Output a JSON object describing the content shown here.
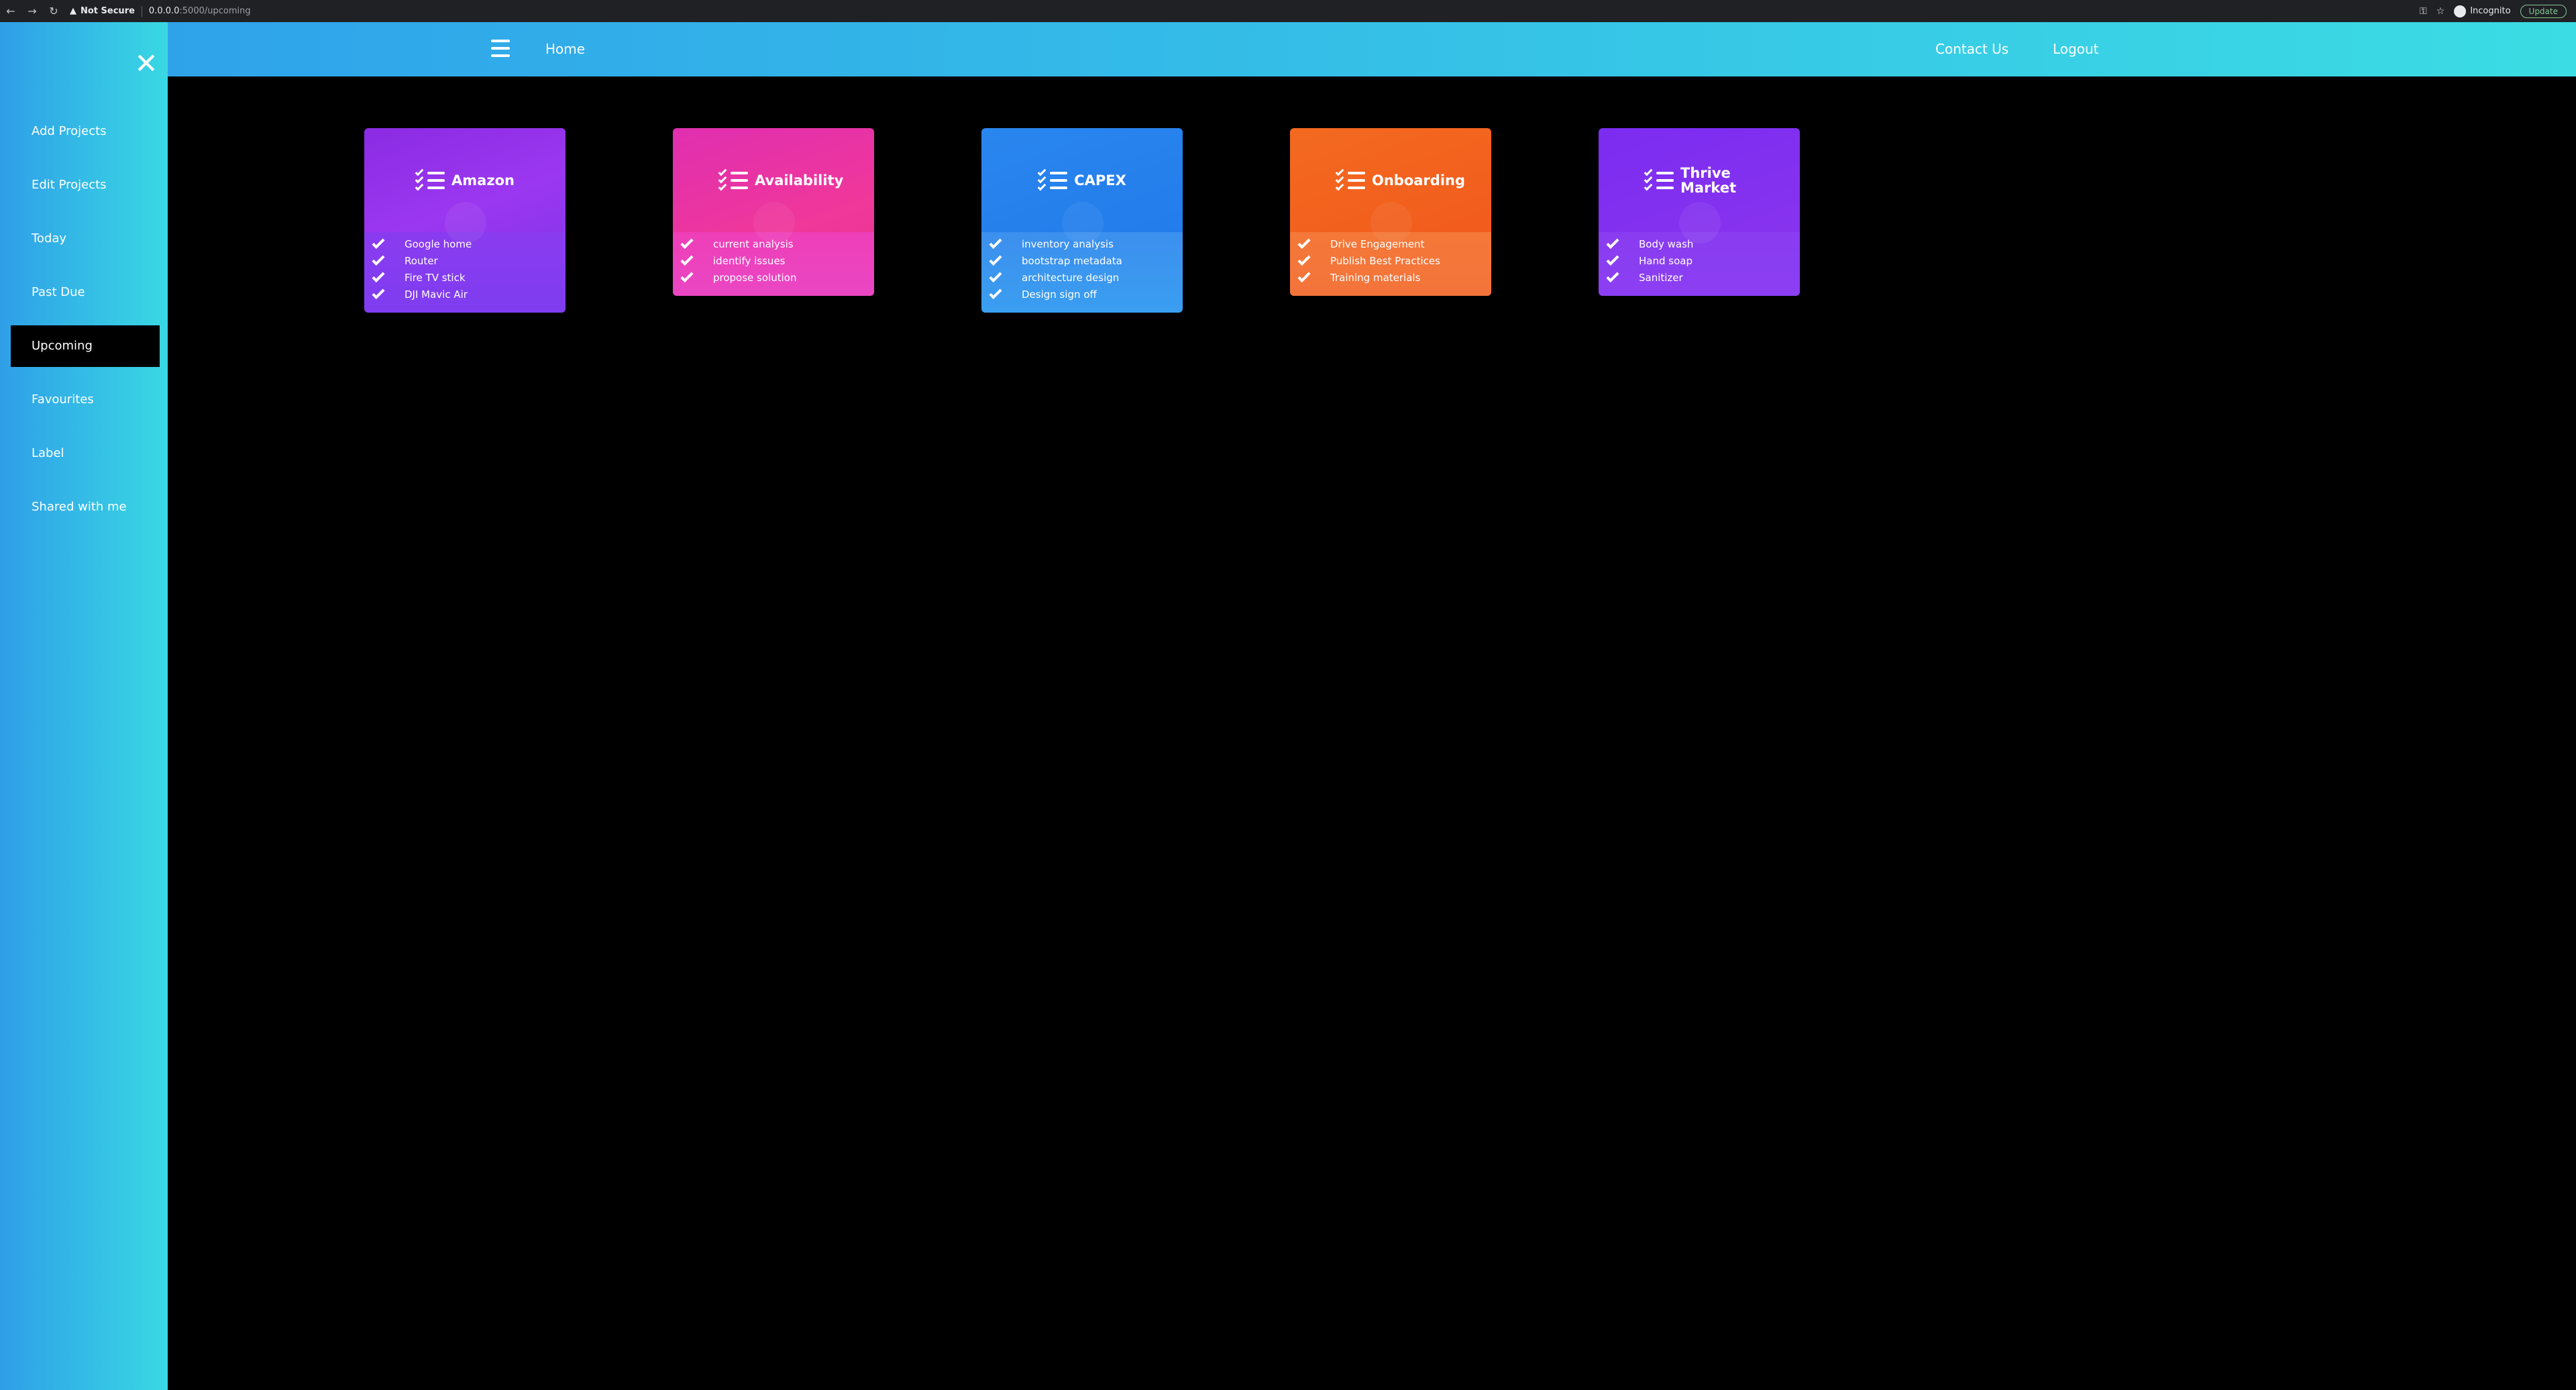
{
  "browser": {
    "security_label": "Not Secure",
    "url_host": "0.0.0.0",
    "url_path": ":5000/upcoming",
    "profile_label": "Incognito",
    "update_label": "Update"
  },
  "sidebar": {
    "items": [
      {
        "label": "Add Projects"
      },
      {
        "label": "Edit Projects"
      },
      {
        "label": "Today"
      },
      {
        "label": "Past Due"
      },
      {
        "label": "Upcoming",
        "active": true
      },
      {
        "label": "Favourites"
      },
      {
        "label": "Label"
      },
      {
        "label": "Shared with me"
      }
    ]
  },
  "header": {
    "home_label": "Home",
    "contact_label": "Contact Us",
    "logout_label": "Logout"
  },
  "cards": [
    {
      "title": "Amazon",
      "items": [
        "Google home",
        "Router",
        "Fire TV stick",
        "DJI Mavic Air"
      ]
    },
    {
      "title": "Availability",
      "items": [
        "current analysis",
        "identify issues",
        "propose solution"
      ]
    },
    {
      "title": "CAPEX",
      "items": [
        "inventory analysis",
        "bootstrap metadata",
        "architecture design",
        "Design sign off"
      ]
    },
    {
      "title": "Onboarding",
      "items": [
        "Drive Engagement",
        "Publish Best Practices",
        "Training materials"
      ]
    },
    {
      "title": "Thrive Market",
      "items": [
        "Body wash",
        "Hand soap",
        "Sanitizer"
      ]
    }
  ]
}
